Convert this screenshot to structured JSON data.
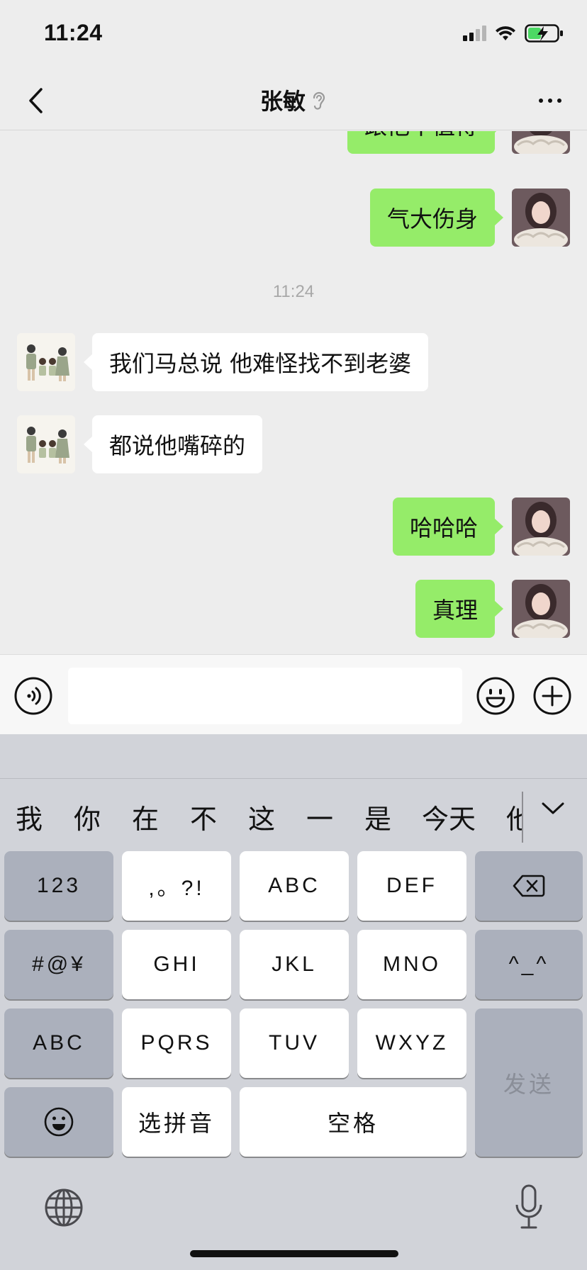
{
  "status_bar": {
    "time": "11:24"
  },
  "nav": {
    "title": "张敏"
  },
  "chat": {
    "messages": [
      {
        "side": "out",
        "text": "跟他不值得"
      },
      {
        "side": "out",
        "text": "气大伤身"
      },
      {
        "timestamp": "11:24"
      },
      {
        "side": "in",
        "text": "我们马总说 他难怪找不到老婆"
      },
      {
        "side": "in",
        "text": "都说他嘴碎的"
      },
      {
        "side": "out",
        "text": "哈哈哈"
      },
      {
        "side": "out",
        "text": "真理"
      }
    ]
  },
  "input": {
    "value": ""
  },
  "keyboard": {
    "candidates": [
      "我",
      "你",
      "在",
      "不",
      "这",
      "一",
      "是",
      "今天",
      "他"
    ],
    "rows": {
      "r1": [
        "123",
        ",。?!",
        "ABC",
        "DEF"
      ],
      "r2": [
        "#@¥",
        "GHI",
        "JKL",
        "MNO",
        "^_^"
      ],
      "r3": [
        "ABC",
        "PQRS",
        "TUV",
        "WXYZ"
      ],
      "r4": [
        "选拼音",
        "空格"
      ],
      "send": "发送"
    }
  },
  "colors": {
    "outgoing_bubble": "#95ec69",
    "incoming_bubble": "#ffffff",
    "chat_background": "#ededed",
    "keyboard_background": "#d1d3d9"
  },
  "icons": [
    "back-chevron-icon",
    "ear-icon",
    "more-dots-icon",
    "voice-icon",
    "emoji-icon",
    "add-icon",
    "backspace-icon",
    "smiley-key-icon",
    "globe-icon",
    "microphone-icon",
    "chevron-down-icon"
  ]
}
